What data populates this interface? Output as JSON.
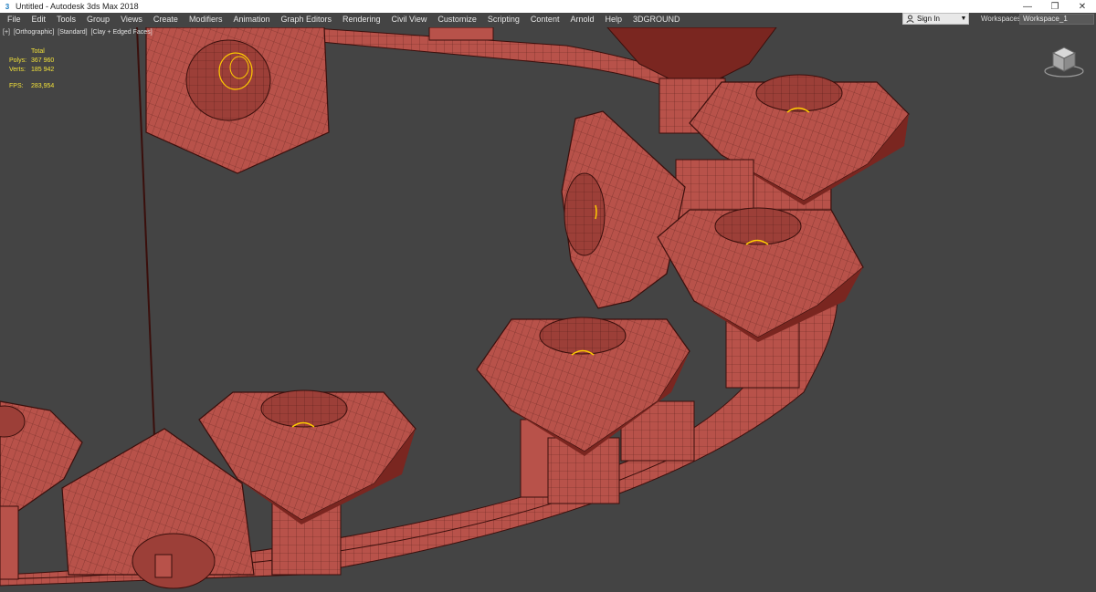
{
  "window": {
    "title": "Untitled - Autodesk 3ds Max 2018",
    "app_icon": "3"
  },
  "menu": [
    "File",
    "Edit",
    "Tools",
    "Group",
    "Views",
    "Create",
    "Modifiers",
    "Animation",
    "Graph Editors",
    "Rendering",
    "Civil View",
    "Customize",
    "Scripting",
    "Content",
    "Arnold",
    "Help",
    "3DGROUND"
  ],
  "signin": {
    "label": "Sign In"
  },
  "workspaces": {
    "label": "Workspaces:",
    "value": "Workspace_1"
  },
  "viewport": {
    "labels": [
      "[+]",
      "[Orthographic]",
      "[Standard]",
      "[Clay + Edged Faces]"
    ],
    "stats": {
      "header": "Total",
      "polys_label": "Polys:",
      "polys_value": "367 960",
      "verts_label": "Verts:",
      "verts_value": "185 942",
      "fps_label": "FPS:",
      "fps_value": "283,954"
    }
  },
  "colors": {
    "viewport_bg": "#444444",
    "clay": "#b8524a",
    "clay_dark": "#7a2620",
    "wire": "#3a0f0c",
    "selection": "#ffcc00",
    "stats_text": "#f2e13a"
  },
  "icons": {
    "app": "app-3dsmax-icon",
    "user": "user-icon",
    "dropdown": "chevron-down-icon",
    "viewcube": "viewcube-icon"
  }
}
